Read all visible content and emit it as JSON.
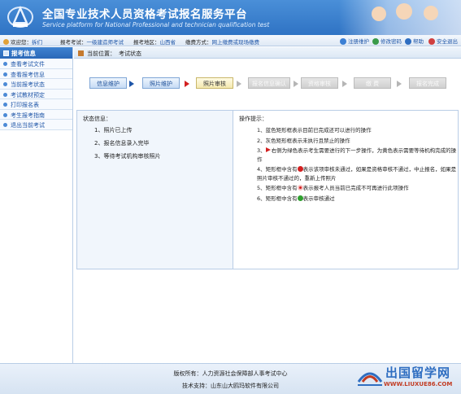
{
  "header": {
    "title": "全国专业技术人员资格考试报名服务平台",
    "subtitle": "Service platform for National Professional and technician qualification test"
  },
  "infobar": {
    "welcome_label": "欢迎您：",
    "user_name": "拆们",
    "exam_label": "报考考试：",
    "exam_value": "一级建造师考试",
    "region_label": "报考地区：",
    "region_value": "山西省",
    "payment_label": "缴费方式：",
    "payment_value": "网上缴费或现场缴费",
    "links": [
      {
        "label": "注册维护",
        "color": "#3b7fd4"
      },
      {
        "label": "修改密码",
        "color": "#3a9b4a"
      },
      {
        "label": "帮助",
        "color": "#2f6ec1"
      },
      {
        "label": "安全退出",
        "color": "#d04040"
      }
    ]
  },
  "sidebar": {
    "heading": "报考信息",
    "items": [
      {
        "label": "查看考试文件"
      },
      {
        "label": "查看报考信息"
      },
      {
        "label": "当前报考状态"
      },
      {
        "label": "考试教材预定"
      },
      {
        "label": "打印报名表"
      },
      {
        "label": "考生报考指南"
      },
      {
        "label": "退出当前考试"
      }
    ]
  },
  "breadcrumb": {
    "label": "当前位置：",
    "page": "考试状态"
  },
  "steps": [
    {
      "label": "信息维护",
      "state": "done"
    },
    {
      "label": "照片维护",
      "state": "done"
    },
    {
      "label": "照片审核",
      "state": "current"
    },
    {
      "label": "报名信息确认",
      "state": "todo"
    },
    {
      "label": "资格审核",
      "state": "todo"
    },
    {
      "label": "缴 费",
      "state": "todo"
    },
    {
      "label": "报名完成",
      "state": "todo"
    }
  ],
  "status_panel": {
    "title": "状态信息：",
    "lines": [
      "1、照片已上传",
      "2、报名信息录入完毕",
      "3、等待考试机构审核照片"
    ]
  },
  "tips_panel": {
    "title": "操作提示：",
    "tips": [
      {
        "prefix": "1、蓝色矩形框表示目前已完成还可以进行的操作",
        "suffix": ""
      },
      {
        "prefix": "2、灰色矩形框表示未执行且禁止的操作",
        "suffix": ""
      },
      {
        "prefix": "3、",
        "icon": "red-arrow-icon",
        "icon_color": "#d32020",
        "suffix": "右侧为绿色表示考生需要进行的下一步操作，为黄色表示需要等待机构完成的操作"
      },
      {
        "prefix": "4、矩形框中含有",
        "icon": "red-exclamation-icon",
        "icon_color": "#d32020",
        "suffix": "表示该项审核未通过，如果是资格审核不通过，中止报名，如果是照片审核不通过的，重新上传照片"
      },
      {
        "prefix": "5、矩形框中含有",
        "icon": "forbidden-icon",
        "icon_color": "#d32020",
        "suffix": "表示报考人员当前已完成不可再进行此项操作"
      },
      {
        "prefix": "6、矩形框中含有",
        "icon": "green-check-icon",
        "icon_color": "#2fa02f",
        "suffix": "表示审核通过"
      }
    ]
  },
  "footer": {
    "owner": "版权所有：人力资源社会保障部人事考试中心",
    "support": "技术支持：山东山大鸥玛软件有限公司"
  },
  "watermark": {
    "text": "出国留学网",
    "url": "WWW.LIUXUE86.COM"
  }
}
